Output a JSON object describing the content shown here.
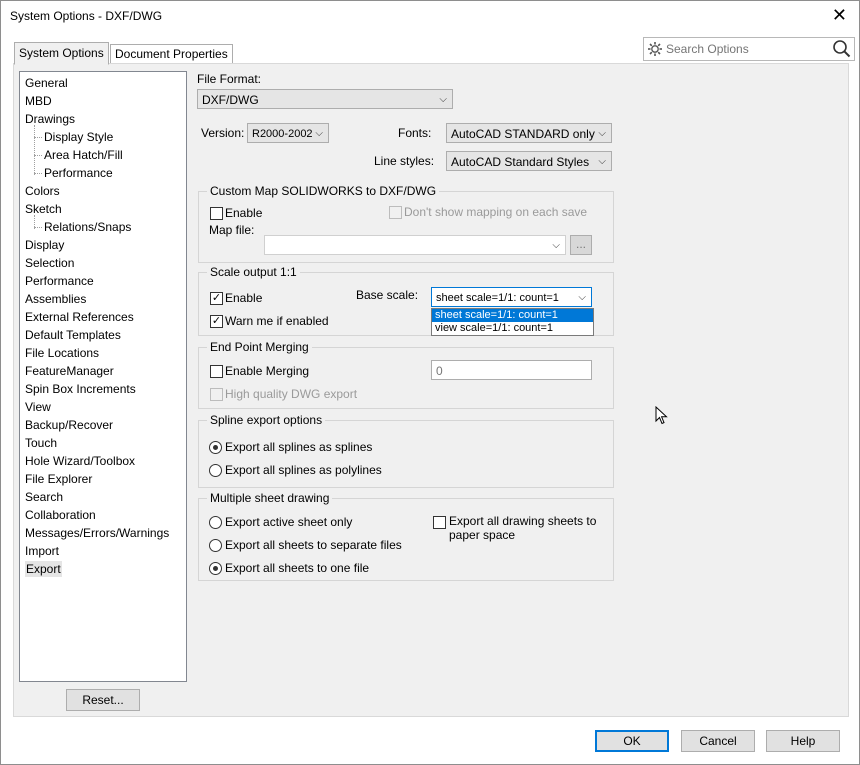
{
  "window": {
    "title": "System Options - DXF/DWG",
    "close_icon": "close-icon"
  },
  "tabs": [
    {
      "label": "System Options",
      "active": true
    },
    {
      "label": "Document Properties",
      "active": false
    }
  ],
  "search": {
    "placeholder": "Search Options"
  },
  "tree": {
    "items": [
      {
        "label": "General",
        "level": 0
      },
      {
        "label": "MBD",
        "level": 0
      },
      {
        "label": "Drawings",
        "level": 0
      },
      {
        "label": "Display Style",
        "level": 1
      },
      {
        "label": "Area Hatch/Fill",
        "level": 1
      },
      {
        "label": "Performance",
        "level": 1
      },
      {
        "label": "Colors",
        "level": 0
      },
      {
        "label": "Sketch",
        "level": 0
      },
      {
        "label": "Relations/Snaps",
        "level": 1
      },
      {
        "label": "Display",
        "level": 0
      },
      {
        "label": "Selection",
        "level": 0
      },
      {
        "label": "Performance",
        "level": 0
      },
      {
        "label": "Assemblies",
        "level": 0
      },
      {
        "label": "External References",
        "level": 0
      },
      {
        "label": "Default Templates",
        "level": 0
      },
      {
        "label": "File Locations",
        "level": 0
      },
      {
        "label": "FeatureManager",
        "level": 0
      },
      {
        "label": "Spin Box Increments",
        "level": 0
      },
      {
        "label": "View",
        "level": 0
      },
      {
        "label": "Backup/Recover",
        "level": 0
      },
      {
        "label": "Touch",
        "level": 0
      },
      {
        "label": "Hole Wizard/Toolbox",
        "level": 0
      },
      {
        "label": "File Explorer",
        "level": 0
      },
      {
        "label": "Search",
        "level": 0
      },
      {
        "label": "Collaboration",
        "level": 0
      },
      {
        "label": "Messages/Errors/Warnings",
        "level": 0
      },
      {
        "label": "Import",
        "level": 0
      },
      {
        "label": "Export",
        "level": 0,
        "selected": true
      }
    ]
  },
  "reset_button": "Reset...",
  "file_format": {
    "label": "File Format:",
    "value": "DXF/DWG"
  },
  "version": {
    "label": "Version:",
    "value": "R2000-2002"
  },
  "fonts": {
    "label": "Fonts:",
    "value": "AutoCAD STANDARD only"
  },
  "line_styles": {
    "label": "Line styles:",
    "value": "AutoCAD Standard Styles"
  },
  "custom_map": {
    "title": "Custom Map SOLIDWORKS to DXF/DWG",
    "enable_label": "Enable",
    "enable_checked": false,
    "dont_show_label": "Don't show mapping on each save",
    "map_file_label": "Map file:",
    "map_file_value": "",
    "browse_label": "..."
  },
  "scale_output": {
    "title": "Scale output 1:1",
    "enable_label": "Enable",
    "enable_checked": true,
    "warn_label": "Warn me if enabled",
    "warn_checked": true,
    "base_scale_label": "Base scale:",
    "base_scale_value": "sheet scale=1/1: count=1",
    "options": [
      "sheet scale=1/1: count=1",
      "view scale=1/1: count=1"
    ]
  },
  "end_point": {
    "title": "End Point Merging",
    "enable_label": "Enable Merging",
    "enable_checked": false,
    "value": "0",
    "hq_label": "High quality DWG export"
  },
  "spline": {
    "title": "Spline export options",
    "opt1": "Export all splines as splines",
    "opt2": "Export all splines as polylines",
    "selected": 1
  },
  "multi_sheet": {
    "title": "Multiple sheet drawing",
    "opt1": "Export active sheet only",
    "opt2": "Export all sheets to separate files",
    "opt3": "Export all sheets to one file",
    "selected": 3,
    "paper_space_line1": "Export all drawing sheets to",
    "paper_space_line2": "paper space",
    "paper_space_checked": false
  },
  "buttons": {
    "ok": "OK",
    "cancel": "Cancel",
    "help": "Help"
  },
  "colors": {
    "accent": "#0078d7",
    "panel": "#f0f0f0"
  }
}
